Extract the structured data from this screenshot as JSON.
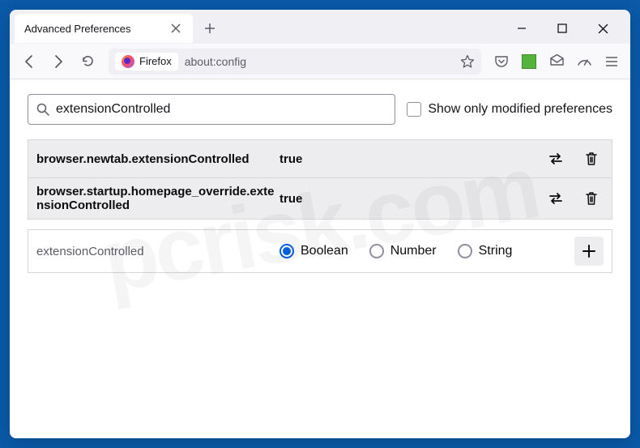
{
  "tab": {
    "title": "Advanced Preferences"
  },
  "urlbar": {
    "identity_label": "Firefox",
    "url": "about:config"
  },
  "search": {
    "value": "extensionControlled",
    "checkbox_label": "Show only modified preferences"
  },
  "prefs": [
    {
      "name": "browser.newtab.extensionControlled",
      "value": "true"
    },
    {
      "name": "browser.startup.homepage_override.extensionControlled",
      "value": "true"
    }
  ],
  "add_row": {
    "name": "extensionControlled",
    "types": [
      "Boolean",
      "Number",
      "String"
    ],
    "selected": "Boolean"
  },
  "watermark": "pcrisk.com"
}
